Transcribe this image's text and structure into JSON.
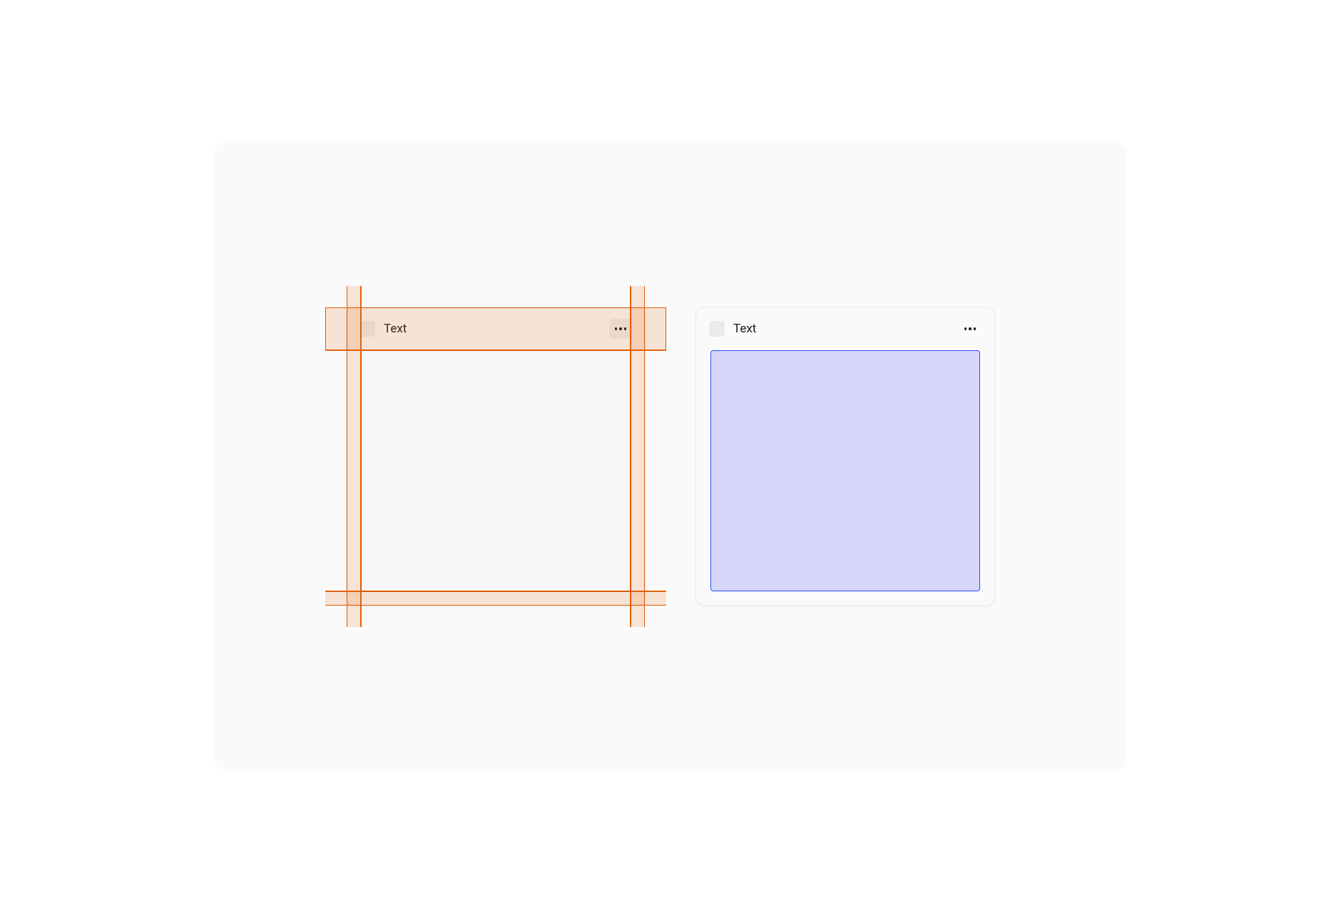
{
  "cards": {
    "left": {
      "title": "Text",
      "more_button_highlighted": true
    },
    "right": {
      "title": "Text",
      "more_button_highlighted": false
    }
  },
  "colors": {
    "guide": "#e05a00",
    "guide_fill": "rgba(224,90,0,0.14)",
    "selection_border": "#2a4cff",
    "selection_fill": "#d6d6fb",
    "card_bg": "#fafafa",
    "canvas_bg": "#fafafa"
  },
  "icons": {
    "more": "more-icon",
    "placeholder": "placeholder-icon"
  }
}
